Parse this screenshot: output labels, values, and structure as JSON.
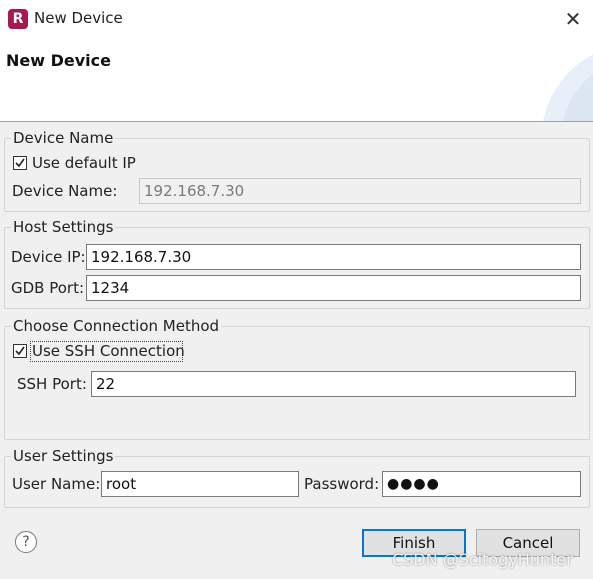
{
  "window": {
    "app_icon_letter": "R",
    "title": "New Device",
    "close_glyph": "✕"
  },
  "header": {
    "title": "New Device"
  },
  "device_name_group": {
    "legend": "Device Name",
    "use_default_ip_label": "Use default IP",
    "use_default_ip_checked": true,
    "device_name_label": "Device Name:",
    "device_name_value": "192.168.7.30"
  },
  "host_settings_group": {
    "legend": "Host Settings",
    "device_ip_label": "Device IP:",
    "device_ip_value": "192.168.7.30",
    "gdb_port_label": "GDB Port:",
    "gdb_port_value": "1234"
  },
  "connection_group": {
    "legend": "Choose Connection Method",
    "use_ssh_label": "Use SSH Connection",
    "use_ssh_checked": true,
    "ssh_port_label": "SSH Port:",
    "ssh_port_value": "22"
  },
  "user_settings_group": {
    "legend": "User Settings",
    "user_name_label": "User Name:",
    "user_name_value": "root",
    "password_label": "Password:",
    "password_value": "●●●●"
  },
  "footer": {
    "help_glyph": "?",
    "finish_label": "Finish",
    "cancel_label": "Cancel"
  },
  "watermark": "CSDN @ScitogyHunter",
  "colors": {
    "app_icon": "#a8174f",
    "default_button_border": "#0078d7",
    "dialog_background": "#f0f0f0"
  }
}
